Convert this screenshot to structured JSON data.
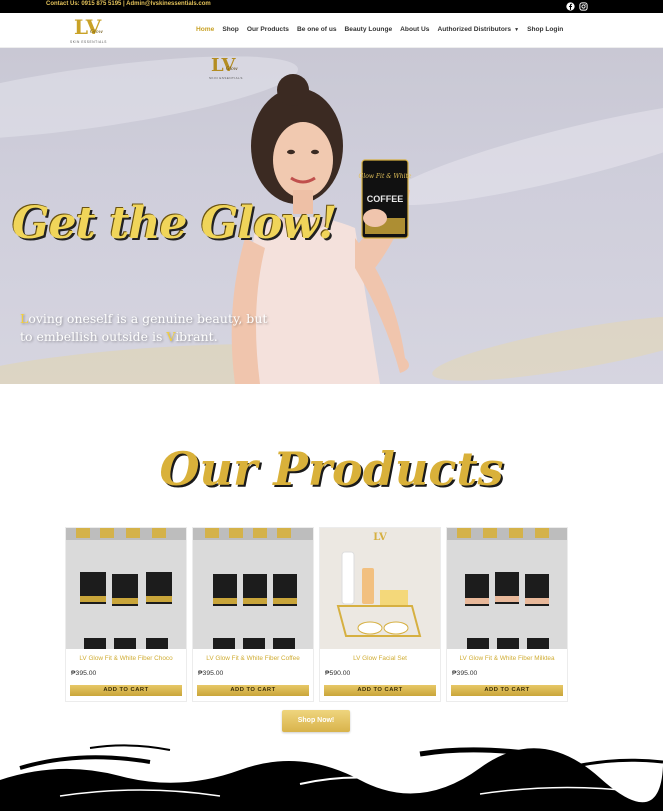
{
  "topbar": {
    "contact": "Contact Us: 0915 875 5195 | Admin@lvskinessentials.com",
    "icons": [
      "facebook-icon",
      "instagram-icon"
    ]
  },
  "header": {
    "logo": {
      "monogram": "LV",
      "script": "Get the Glow",
      "subtitle": "SKIN ESSENTIALS"
    },
    "nav": [
      {
        "label": "Home",
        "active": true
      },
      {
        "label": "Shop"
      },
      {
        "label": "Our Products"
      },
      {
        "label": "Be one of us"
      },
      {
        "label": "Beauty Lounge"
      },
      {
        "label": "About Us"
      },
      {
        "label": "Authorized Distributors",
        "has_dropdown": true
      },
      {
        "label": "Shop Login"
      }
    ]
  },
  "hero": {
    "title": "Get the Glow!",
    "tagline_parts": [
      {
        "text": "L",
        "gold": true
      },
      {
        "text": "oving oneself is a genuine beauty, but to embellish outside is ",
        "gold": false
      },
      {
        "text": "V",
        "gold": true
      },
      {
        "text": "ibrant.",
        "gold": false
      }
    ],
    "product_box": {
      "brand": "Glow Fit & White",
      "label": "COFFEE"
    }
  },
  "products_section": {
    "title": "Our Products",
    "items": [
      {
        "name": "LV Glow Fit & White Fiber Choco",
        "price": "₱395.00",
        "cart": "ADD TO CART",
        "image": "boxes"
      },
      {
        "name": "LV Glow Fit & White Fiber Coffee",
        "price": "₱395.00",
        "cart": "ADD TO CART",
        "image": "boxes"
      },
      {
        "name": "LV Glow Facial Set",
        "price": "₱590.00",
        "cart": "ADD TO CART",
        "image": "facial-set"
      },
      {
        "name": "LV Glow Fit & White Fiber Milktea",
        "price": "₱395.00",
        "cart": "ADD TO CART",
        "image": "boxes"
      }
    ],
    "shop_now": "Shop Now!"
  },
  "colors": {
    "gold": "#d0ad34",
    "gold_light": "#e7c867",
    "black": "#000000",
    "hero_bg": "#cfcedb"
  }
}
